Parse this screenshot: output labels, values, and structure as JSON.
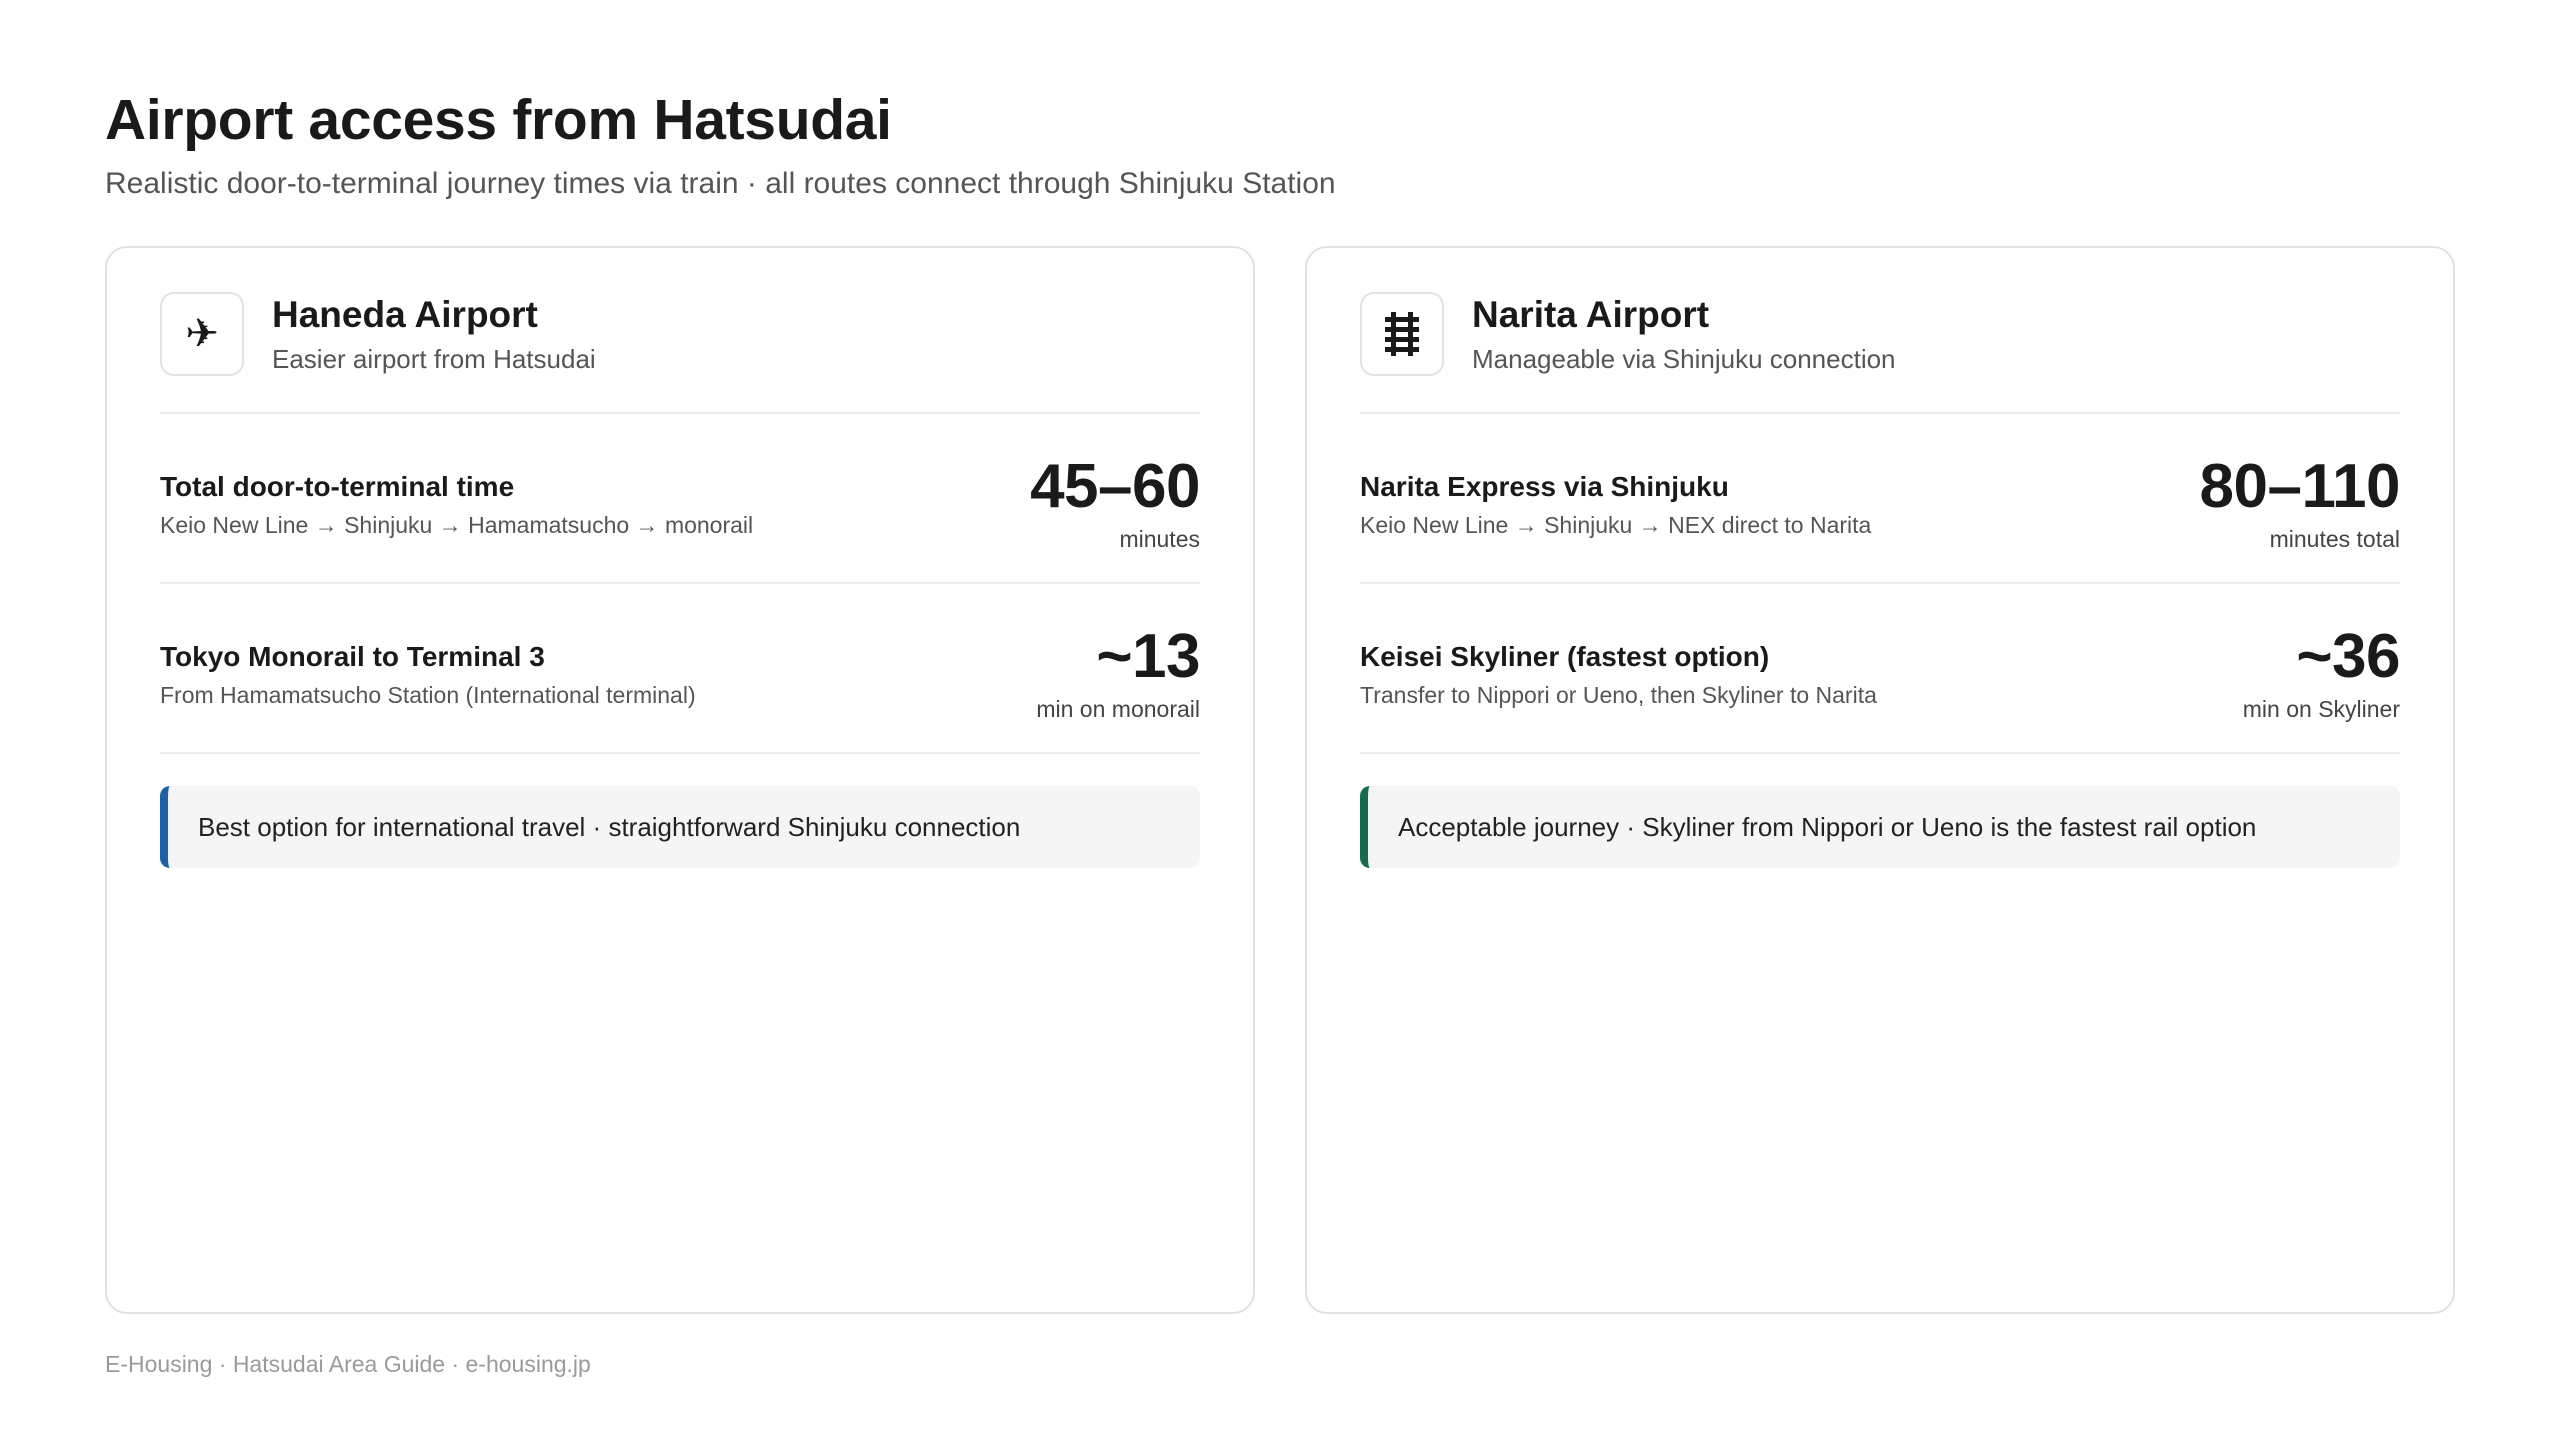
{
  "header": {
    "title": "Airport access from Hatsudai",
    "subtitle": "Realistic door-to-terminal journey times via train · all routes connect through Shinjuku Station"
  },
  "cards": [
    {
      "icon": "airplane-icon",
      "icon_glyph": "✈",
      "title": "Haneda Airport",
      "description": "Easier airport from Hatsudai",
      "accent_color": "#1f5fa6",
      "stats": [
        {
          "label": "Total door-to-terminal time",
          "detail": "Keio New Line → Shinjuku → Hamamatsucho → monorail",
          "value": "45–60",
          "unit": "minutes"
        },
        {
          "label": "Tokyo Monorail to Terminal 3",
          "detail": "From Hamamatsucho Station (International terminal)",
          "value": "~13",
          "unit": "min on monorail"
        }
      ],
      "callout": "Best option for international travel · straightforward Shinjuku connection"
    },
    {
      "icon": "railway-track-icon",
      "icon_glyph": "",
      "title": "Narita Airport",
      "description": "Manageable via Shinjuku connection",
      "accent_color": "#176b4c",
      "stats": [
        {
          "label": "Narita Express via Shinjuku",
          "detail": "Keio New Line → Shinjuku → NEX direct to Narita",
          "value": "80–110",
          "unit": "minutes total"
        },
        {
          "label": "Keisei Skyliner (fastest option)",
          "detail": "Transfer to Nippori or Ueno, then Skyliner to Narita",
          "value": "~36",
          "unit": "min on Skyliner"
        }
      ],
      "callout": "Acceptable journey · Skyliner from Nippori or Ueno is the fastest rail option"
    }
  ],
  "footer": {
    "text": "E-Housing · Hatsudai Area Guide · e-housing.jp"
  }
}
